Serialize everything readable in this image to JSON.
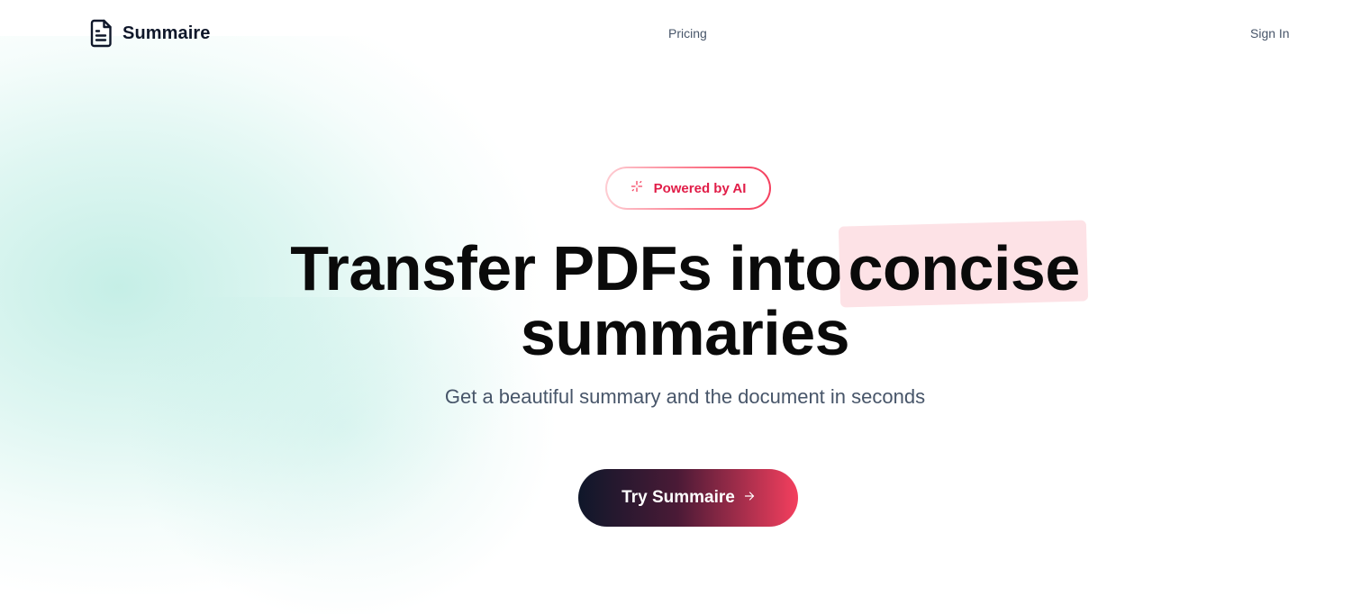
{
  "header": {
    "brand": "Summaire",
    "nav": {
      "pricing": "Pricing",
      "sign_in": "Sign In"
    }
  },
  "hero": {
    "badge": "Powered by AI",
    "headline_part1": "Transfer PDFs into",
    "headline_highlight": "concise",
    "headline_part2": "summaries",
    "subtitle": "Get a beautiful summary and the document in seconds",
    "cta_label": "Try Summaire"
  },
  "icons": {
    "logo": "document-icon",
    "badge": "sparkles-icon",
    "cta": "arrow-right-icon"
  },
  "colors": {
    "accent": "#f43f5e",
    "accent_dark": "#e11d48",
    "highlight_bg": "#fde2e6",
    "cta_start": "#0f172a",
    "glow": "#a9e8dc",
    "text_primary": "#0a0a0a",
    "text_muted": "#475569"
  }
}
